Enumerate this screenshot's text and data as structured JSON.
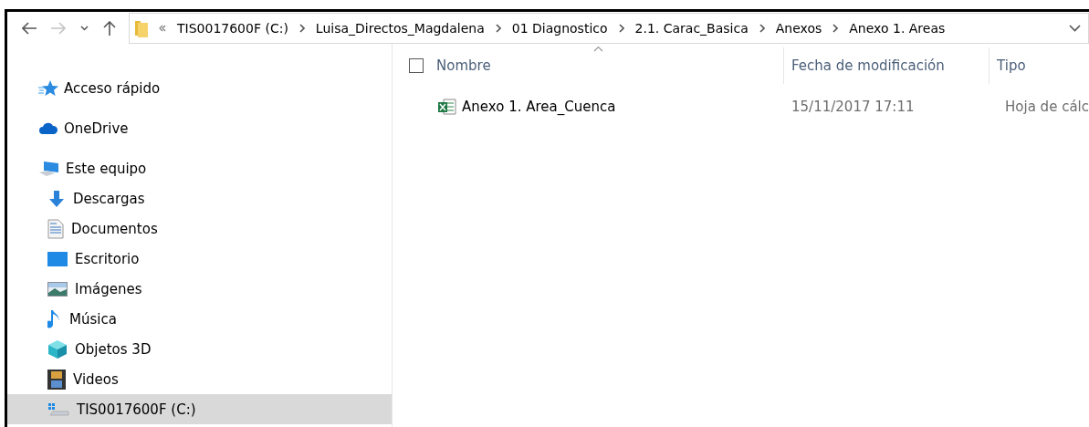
{
  "address_bar": {
    "path": [
      {
        "label": "TIS0017600F (C:)"
      },
      {
        "label": "Luisa_Directos_Magdalena"
      },
      {
        "label": "01 Diagnostico"
      },
      {
        "label": "2.1. Carac_Basica"
      },
      {
        "label": "Anexos"
      },
      {
        "label": "Anexo 1. Areas"
      }
    ]
  },
  "sidebar": {
    "items": [
      {
        "label": "Acceso rápido",
        "selected": false
      },
      {
        "label": "OneDrive",
        "selected": false
      },
      {
        "label": "Este equipo",
        "selected": false,
        "children": [
          {
            "label": "Descargas",
            "selected": false
          },
          {
            "label": "Documentos",
            "selected": false
          },
          {
            "label": "Escritorio",
            "selected": false
          },
          {
            "label": "Imágenes",
            "selected": false
          },
          {
            "label": "Música",
            "selected": false
          },
          {
            "label": "Objetos 3D",
            "selected": false
          },
          {
            "label": "Videos",
            "selected": false
          },
          {
            "label": "TIS0017600F (C:)",
            "selected": true
          }
        ]
      }
    ]
  },
  "file_list": {
    "select_all": {
      "checked": false
    },
    "columns": [
      {
        "label": "Nombre"
      },
      {
        "label": "Fecha de modificación"
      },
      {
        "label": "Tipo"
      }
    ],
    "rows": [
      {
        "name": "Anexo 1. Area_Cuenca",
        "modified": "15/11/2017 17:11",
        "type": "Hoja de cálc"
      }
    ]
  }
}
